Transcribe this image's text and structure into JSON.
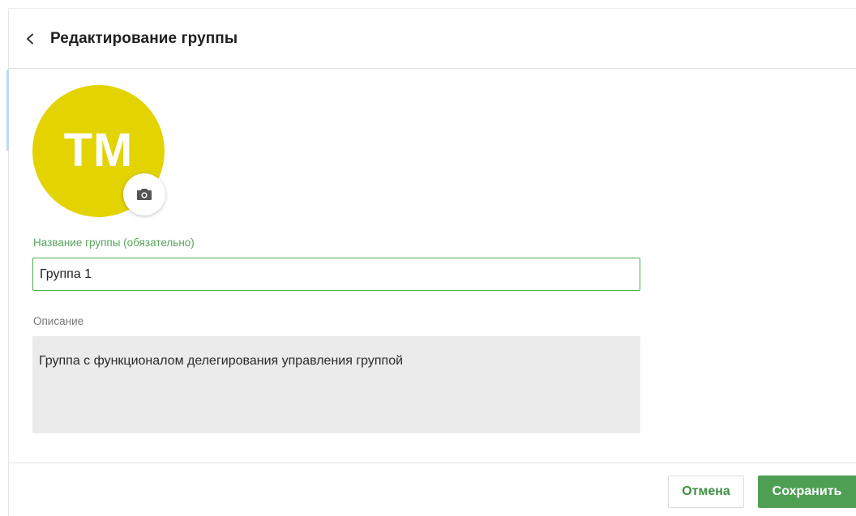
{
  "header": {
    "title": "Редактирование группы"
  },
  "avatar": {
    "initials": "ТМ",
    "color": "#e3d300"
  },
  "form": {
    "name_label": "Название группы (обязательно)",
    "name_value": "Группа 1",
    "description_label": "Описание",
    "description_value": "Группа с функционалом делегирования управления группой"
  },
  "footer": {
    "cancel_label": "Отмена",
    "save_label": "Сохранить"
  },
  "colors": {
    "accent_green": "#4e9f54",
    "label_green": "#58a35c"
  },
  "icons": {
    "back": "chevron-left-icon",
    "camera": "camera-icon"
  }
}
